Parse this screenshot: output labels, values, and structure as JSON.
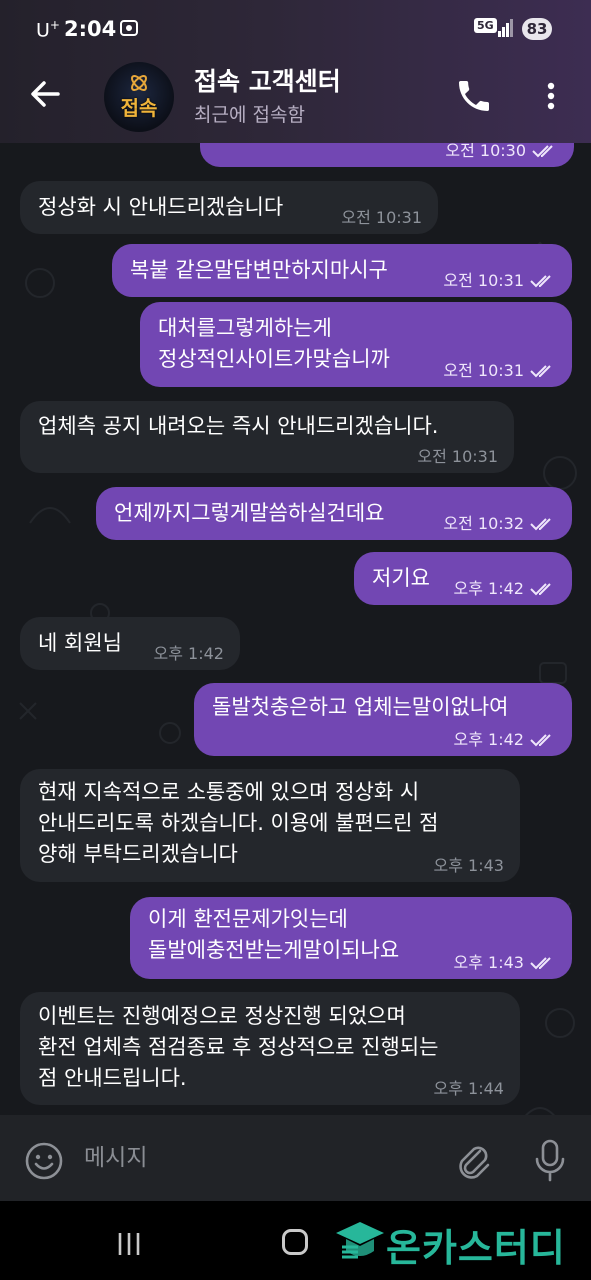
{
  "status_bar": {
    "carrier": "U",
    "carrier_sup": "+",
    "time": "2:04",
    "network": "5G",
    "battery": "83"
  },
  "header": {
    "title": "접속 고객센터",
    "status": "최근에 접속함",
    "avatar_text": "접속"
  },
  "messages": [
    {
      "dir": "out",
      "text": "",
      "time": "오전 10:30",
      "read": true
    },
    {
      "dir": "in",
      "text": "정상화 시 안내드리겠습니다",
      "time": "오전 10:31"
    },
    {
      "dir": "out",
      "text": "복붙 같은말답변만하지마시구",
      "time": "오전 10:31",
      "read": true
    },
    {
      "dir": "out",
      "text": "대처를그렇게하는게\n정상적인사이트가맞습니까",
      "time": "오전 10:31",
      "read": true
    },
    {
      "dir": "in",
      "text": "업체측 공지 내려오는 즉시 안내드리겠습니다.",
      "time": "오전 10:31"
    },
    {
      "dir": "out",
      "text": "언제까지그렇게말씀하실건데요",
      "time": "오전 10:32",
      "read": true
    },
    {
      "dir": "out",
      "text": "저기요",
      "time": "오후 1:42",
      "read": true
    },
    {
      "dir": "in",
      "text": "네 회원님",
      "time": "오후 1:42"
    },
    {
      "dir": "out",
      "text": "돌발첫충은하고 업체는말이없나여",
      "time": "오후 1:42",
      "read": true
    },
    {
      "dir": "in",
      "text": "현재 지속적으로 소통중에 있으며 정상화 시\n안내드리도록 하겠습니다. 이용에 불편드린 점\n양해 부탁드리겠습니다",
      "time": "오후 1:43"
    },
    {
      "dir": "out",
      "text": "이게 환전문제가잇는데\n돌발에충전받는게말이되나요",
      "time": "오후 1:43",
      "read": true
    },
    {
      "dir": "in",
      "text": "이벤트는 진행예정으로 정상진행 되었으며\n환전 업체측 점검종료 후 정상적으로 진행되는\n점 안내드립니다.",
      "time": "오후 1:44"
    }
  ],
  "composer": {
    "placeholder": "메시지"
  },
  "icons": {
    "back": "arrow-left-icon",
    "call": "phone-icon",
    "more": "more-vert-icon",
    "emoji": "emoji-icon",
    "attach": "paperclip-icon",
    "mic": "microphone-icon"
  },
  "watermark": "온카스터디",
  "colors": {
    "outgoing_bubble": "#7247b3",
    "incoming_bubble": "#24272c",
    "background": "#17191d",
    "watermark": "#27b79a"
  }
}
